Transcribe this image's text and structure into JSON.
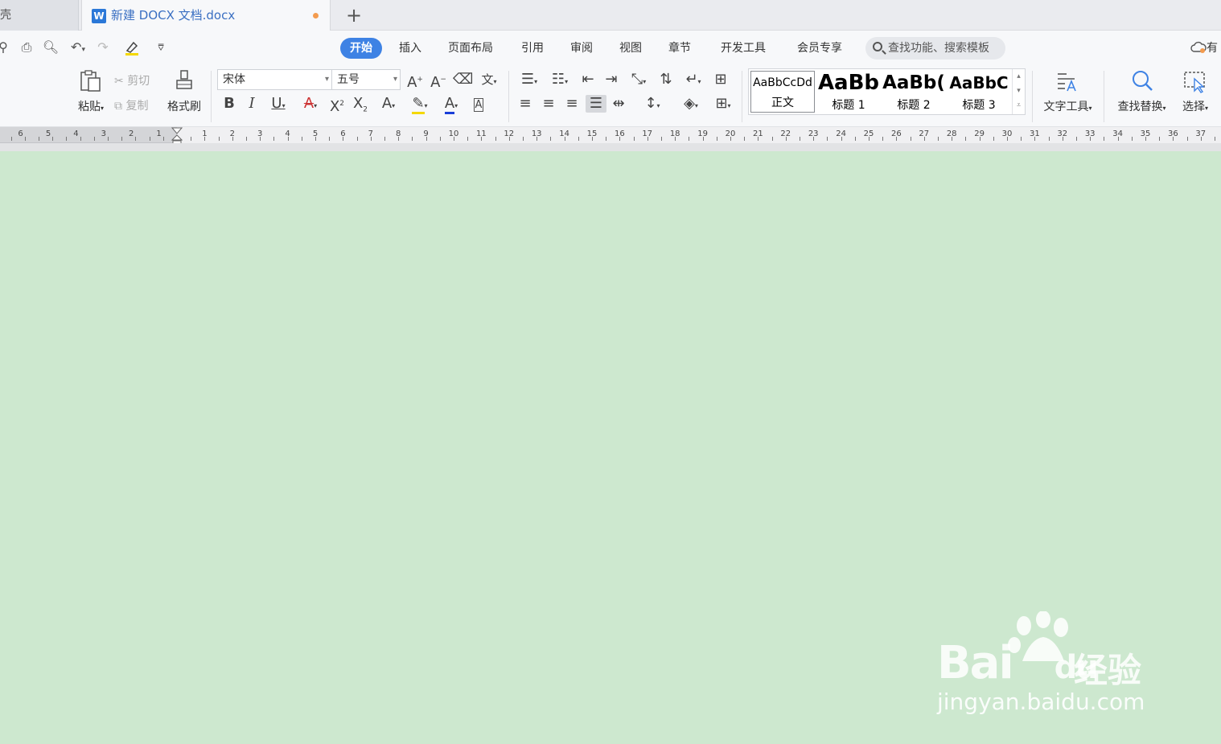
{
  "tabs": {
    "prev_fragment": "壳",
    "active_icon": "W",
    "active_title": "新建 DOCX 文档.docx",
    "new_tab": "+"
  },
  "menubar": {
    "items": [
      "开始",
      "插入",
      "页面布局",
      "引用",
      "审阅",
      "视图",
      "章节",
      "开发工具",
      "会员专享"
    ],
    "active": "开始",
    "search_placeholder": "查找功能、搜索模板",
    "cloud_fragment": "有"
  },
  "ribbon": {
    "paste": "粘贴",
    "cut": "剪切",
    "copy": "复制",
    "format_painter": "格式刷",
    "font_name": "宋体",
    "font_size": "五号",
    "styles": [
      {
        "sample": "AaBbCcDd",
        "label": "正文"
      },
      {
        "sample": "AaBb",
        "label": "标题 1"
      },
      {
        "sample": "AaBb(",
        "label": "标题 2"
      },
      {
        "sample": "AaBbC",
        "label": "标题 3"
      }
    ],
    "text_tools": "文字工具",
    "find_replace": "查找替换",
    "select": "选择"
  },
  "ruler": {
    "left_numbers": [
      "6",
      "5",
      "4",
      "3",
      "2",
      "1"
    ],
    "right_numbers": [
      "1",
      "2",
      "3",
      "4",
      "5",
      "6",
      "7",
      "8",
      "9",
      "10",
      "11",
      "12",
      "13",
      "14",
      "15",
      "16",
      "17",
      "18",
      "19",
      "20",
      "21",
      "22",
      "23",
      "24",
      "25",
      "26",
      "27",
      "28",
      "29",
      "30",
      "31",
      "32",
      "33",
      "34",
      "35",
      "36",
      "37"
    ]
  },
  "watermark": {
    "logo": "Bai",
    "logo_suffix": "du",
    "brand_cn": "经验",
    "url": "jingyan.baidu.com"
  },
  "colors": {
    "page_background": "#cde8cf",
    "accent": "#3e82e4",
    "tab_title": "#3a6fc2"
  }
}
